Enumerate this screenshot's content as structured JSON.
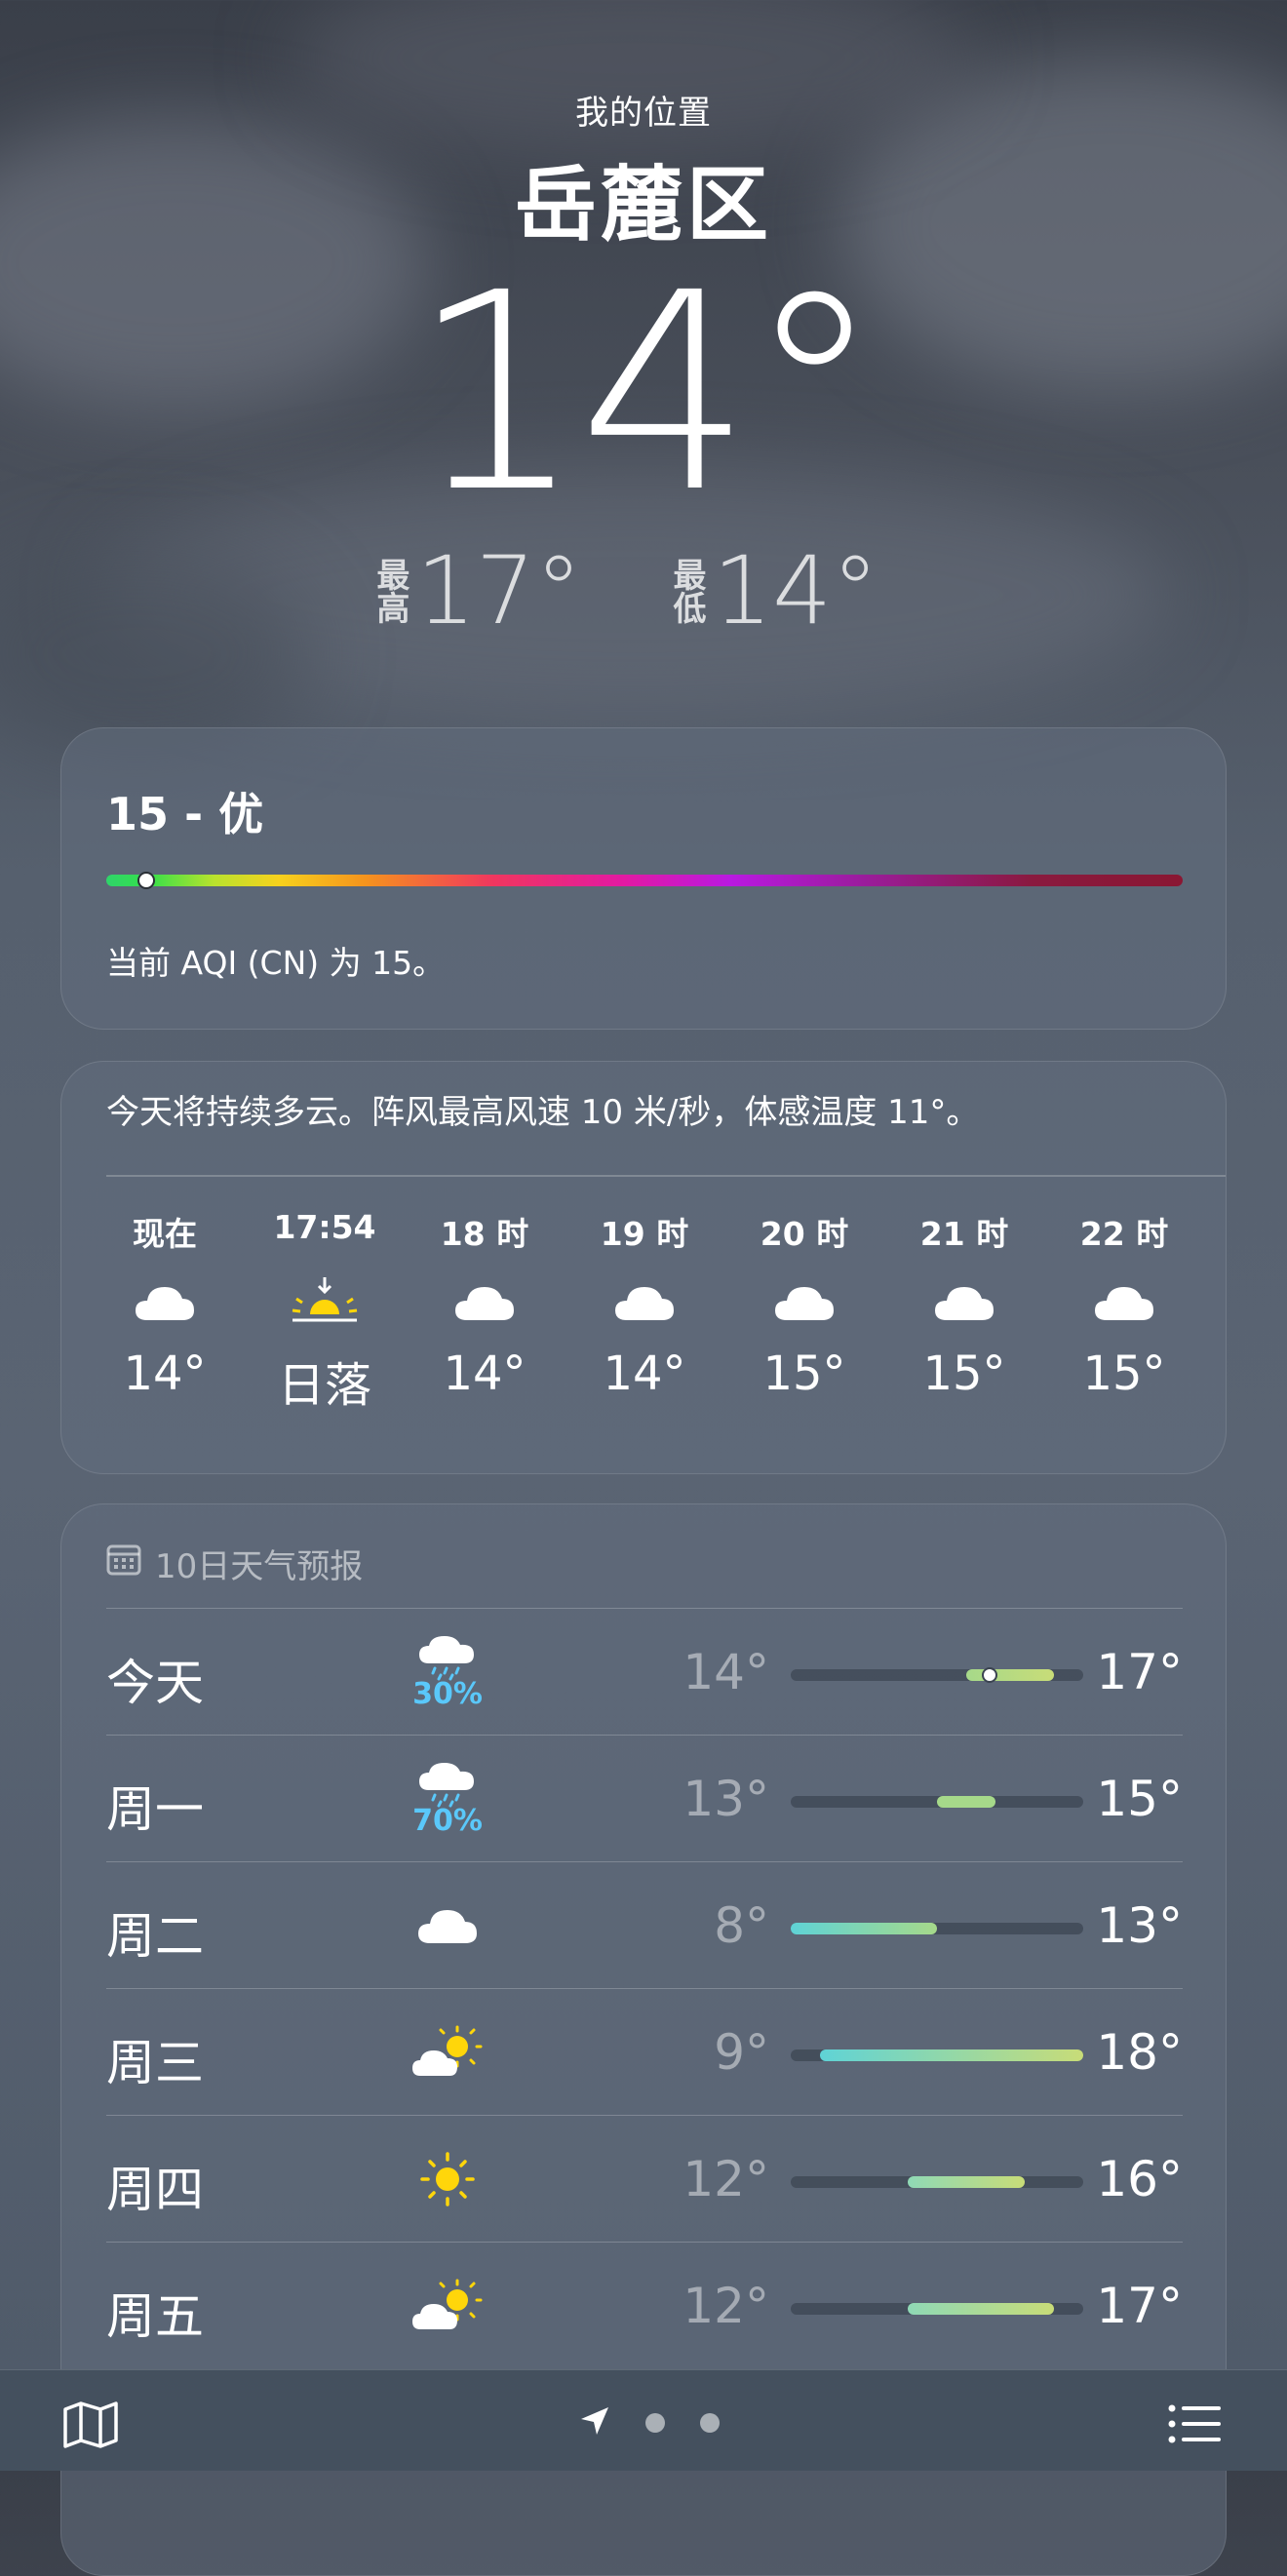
{
  "header": {
    "location_label": "我的位置",
    "city": "岳麓区",
    "current_temp": "14°",
    "high_label": "最高",
    "high": "17°",
    "low_label": "最低",
    "low": "14°"
  },
  "aqi": {
    "value_text": "15 - 优",
    "level_fraction": 0.02,
    "description": "当前 AQI (CN) 为 15。"
  },
  "hourly": {
    "summary": "今天将持续多云。阵风最高风速 10 米/秒，体感温度 11°。",
    "items": [
      {
        "time": "现在",
        "icon": "cloud-icon",
        "value": "14°"
      },
      {
        "time": "17:54",
        "icon": "sunset-icon",
        "value": "日落"
      },
      {
        "time": "18 时",
        "icon": "cloud-icon",
        "value": "14°"
      },
      {
        "time": "19 时",
        "icon": "cloud-icon",
        "value": "14°"
      },
      {
        "time": "20 时",
        "icon": "cloud-icon",
        "value": "15°"
      },
      {
        "time": "21 时",
        "icon": "cloud-icon",
        "value": "15°"
      },
      {
        "time": "22 时",
        "icon": "cloud-icon",
        "value": "15°"
      }
    ]
  },
  "daily": {
    "title": "10日天气预报",
    "range_min": 8,
    "range_max": 18,
    "items": [
      {
        "day": "今天",
        "icon": "cloud-rain-icon",
        "precip": "30%",
        "low": "14°",
        "high": "17°",
        "low_val": 14,
        "high_val": 17,
        "current_val": 14
      },
      {
        "day": "周一",
        "icon": "cloud-rain-icon",
        "precip": "70%",
        "low": "13°",
        "high": "15°",
        "low_val": 13,
        "high_val": 15
      },
      {
        "day": "周二",
        "icon": "cloud-icon",
        "precip": "",
        "low": "8°",
        "high": "13°",
        "low_val": 8,
        "high_val": 13
      },
      {
        "day": "周三",
        "icon": "partly-sunny-icon",
        "precip": "",
        "low": "9°",
        "high": "18°",
        "low_val": 9,
        "high_val": 18
      },
      {
        "day": "周四",
        "icon": "sun-icon",
        "precip": "",
        "low": "12°",
        "high": "16°",
        "low_val": 12,
        "high_val": 16
      },
      {
        "day": "周五",
        "icon": "partly-sunny-icon",
        "precip": "",
        "low": "12°",
        "high": "17°",
        "low_val": 12,
        "high_val": 17
      }
    ]
  },
  "tabbar": {
    "map_icon": "map-icon",
    "location_icon": "location-arrow-icon",
    "page_count": 2,
    "list_icon": "list-icon"
  },
  "colors": {
    "precip": "#5ac8fa",
    "sun": "#ffd60a"
  }
}
